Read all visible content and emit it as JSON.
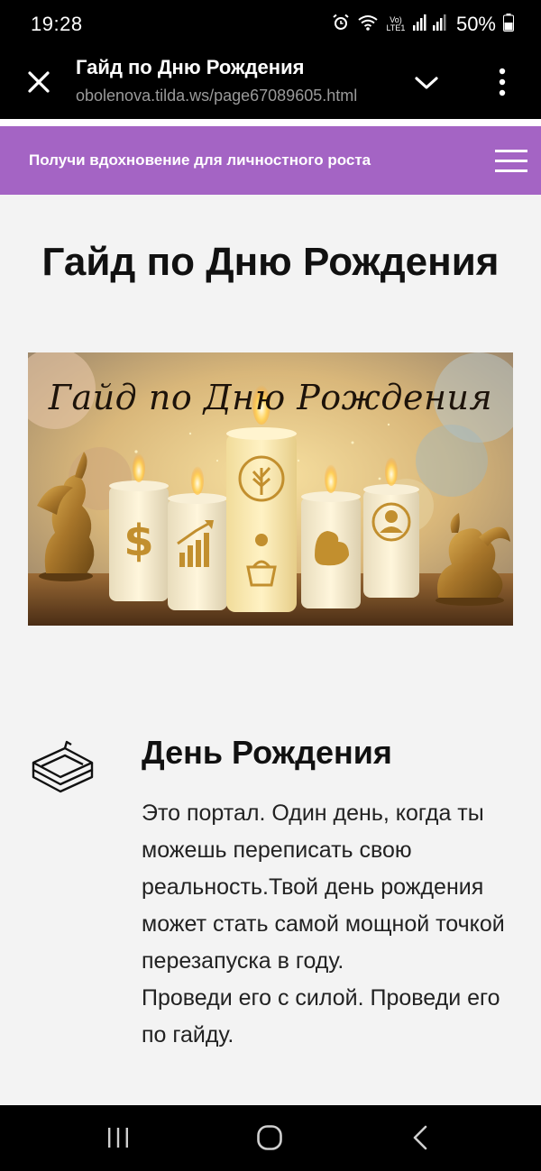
{
  "status_bar": {
    "time": "19:28",
    "network_label": "Vo) LTE1",
    "battery": "50%",
    "icons": [
      "alarm-icon",
      "wifi-icon",
      "signal-icon",
      "battery-icon"
    ]
  },
  "browser": {
    "tab_title": "Гайд по Дню Рождения",
    "url": "obolenova.tilda.ws/page67089605.html",
    "icons": [
      "close-icon",
      "chevron-down-icon",
      "more-vertical-icon"
    ]
  },
  "site_header": {
    "title": "Получи вдохновение для личностного роста",
    "menu_icon": "hamburger-menu-icon",
    "background": "#a464c4"
  },
  "page": {
    "title": "Гайд по Дню Рождения"
  },
  "hero": {
    "caption": "Гайд по Дню Рождения",
    "candle_symbols": [
      "$",
      "chart",
      "tree",
      "muscle",
      "person"
    ]
  },
  "section": {
    "icon": "book-icon",
    "title": "День Рождения",
    "paragraph_1": "Это портал. Один день, когда ты можешь переписать свою реальность.Твой день рождения может стать самой мощной точкой перезапуска в году.",
    "paragraph_2": "Проведи его с силой. Проведи его по гайду."
  },
  "nav_bar": {
    "icons": [
      "recents-icon",
      "home-icon",
      "back-icon"
    ]
  }
}
